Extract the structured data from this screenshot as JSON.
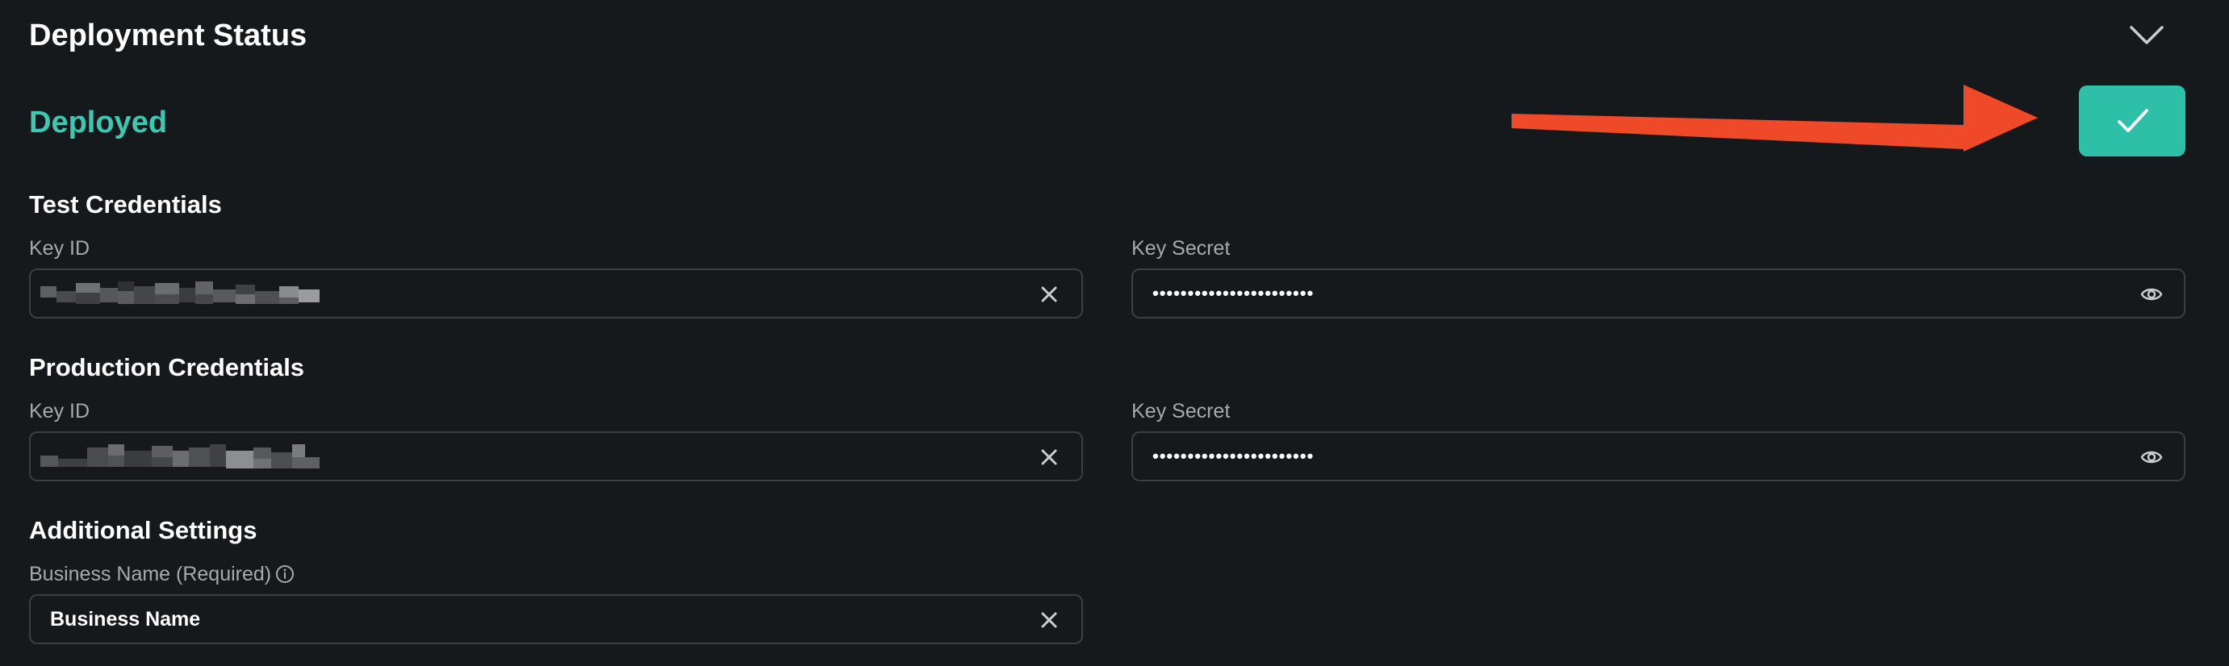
{
  "header": {
    "title": "Deployment Status",
    "collapse_icon": "chevron-down-icon"
  },
  "status": {
    "label": "Deployed",
    "color": "#3cc8b1",
    "confirm_icon": "checkmark-icon",
    "confirm_button_color": "#2ebfa8",
    "annotation_arrow_color": "#ee4a2a"
  },
  "test_credentials": {
    "title": "Test Credentials",
    "key_id_label": "Key ID",
    "key_id_value": "",
    "key_secret_label": "Key Secret",
    "key_secret_value": "•••••••••••••••••••••••"
  },
  "production_credentials": {
    "title": "Production Credentials",
    "key_id_label": "Key ID",
    "key_id_value": "",
    "key_secret_label": "Key Secret",
    "key_secret_value": "•••••••••••••••••••••••"
  },
  "additional_settings": {
    "title": "Additional Settings",
    "business_name_label": "Business Name (Required)",
    "business_name_value": "Business Name"
  }
}
